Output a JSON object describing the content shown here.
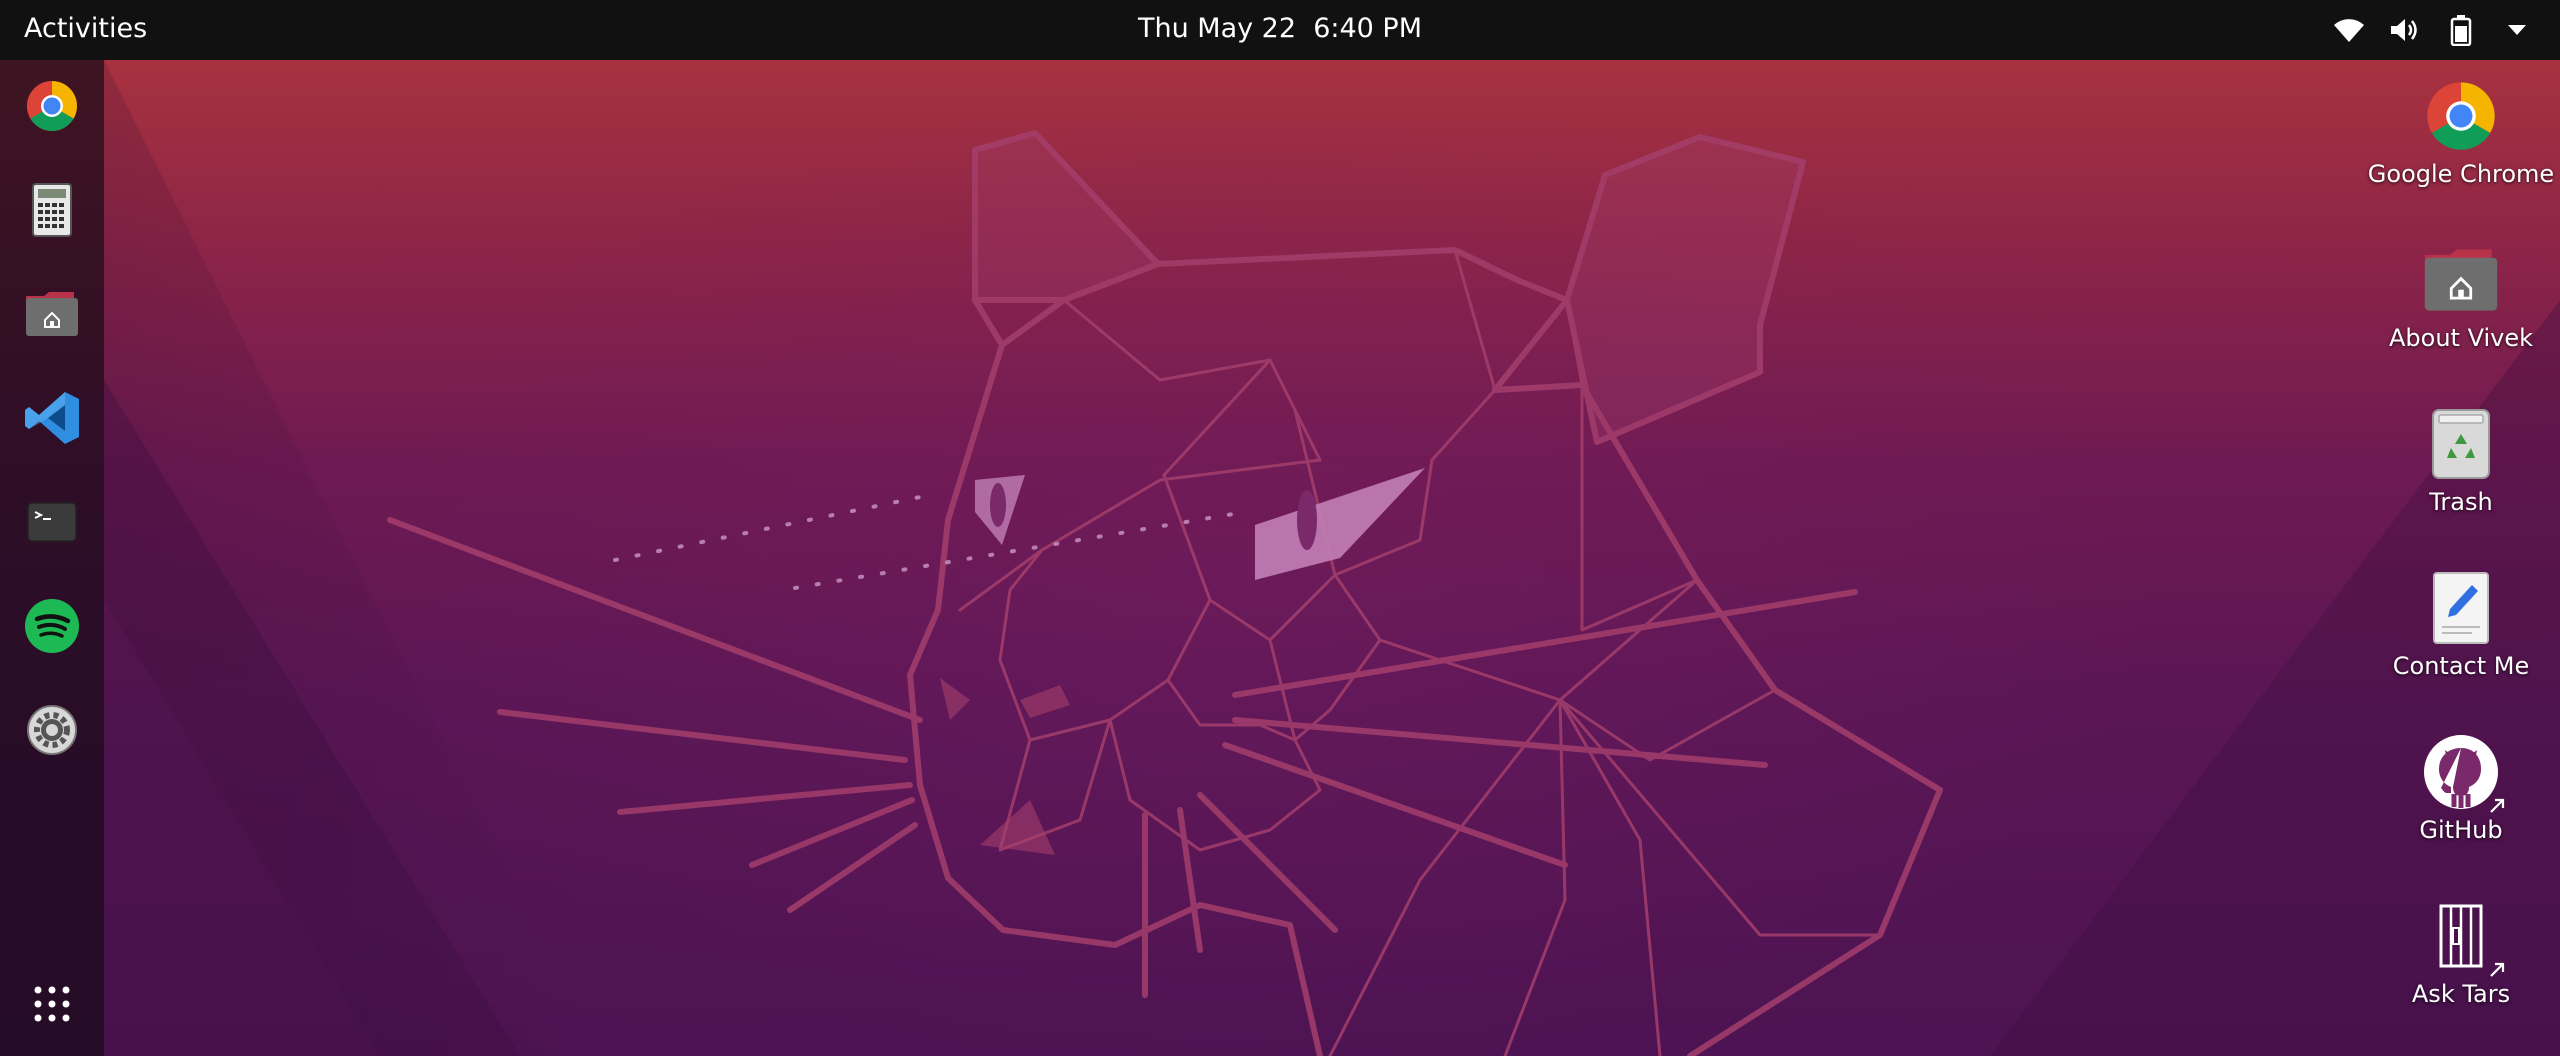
{
  "topbar": {
    "activities_label": "Activities",
    "clock": "Thu May 22  6:40 PM",
    "tray_icons": [
      "wifi-icon",
      "volume-icon",
      "battery-icon",
      "system-menu-arrow-icon"
    ]
  },
  "dock": {
    "items": [
      {
        "name": "Google Chrome",
        "icon": "chrome-icon"
      },
      {
        "name": "Calculator",
        "icon": "calculator-icon"
      },
      {
        "name": "Files",
        "icon": "home-folder-icon"
      },
      {
        "name": "Visual Studio Code",
        "icon": "vscode-icon"
      },
      {
        "name": "Terminal",
        "icon": "terminal-icon"
      },
      {
        "name": "Spotify",
        "icon": "spotify-icon"
      },
      {
        "name": "Settings",
        "icon": "settings-icon"
      }
    ],
    "show_applications_icon": "app-grid-icon"
  },
  "desktop": {
    "items": [
      {
        "label": "Google Chrome",
        "icon": "chrome-icon"
      },
      {
        "label": "About Vivek",
        "icon": "home-folder-icon"
      },
      {
        "label": "Trash",
        "icon": "trash-icon"
      },
      {
        "label": "Contact Me",
        "icon": "text-editor-icon"
      },
      {
        "label": "GitHub",
        "icon": "github-icon"
      },
      {
        "label": "Ask Tars",
        "icon": "tars-icon"
      }
    ]
  },
  "colors": {
    "topbar": "#111111",
    "wallpaper_top": "#a7323f",
    "wallpaper_bottom": "#4d1352",
    "chrome_red": "#db4437",
    "chrome_yellow": "#f4b400",
    "chrome_green": "#0f9d58",
    "chrome_blue": "#4285f4",
    "spotify_green": "#1db954",
    "vscode_blue": "#2f8ee0"
  }
}
